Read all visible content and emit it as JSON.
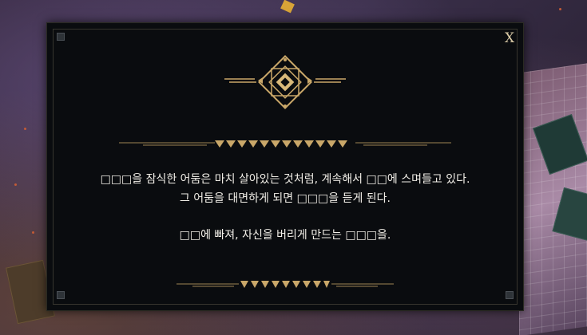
{
  "dialog": {
    "close_label": "X",
    "lines": [
      "□□□을 잠식한 어둠은 마치 살아있는 것처럼, 계속해서 □□에 스며들고 있다.",
      "그 어둠을 대면하게 되면 □□□을 듣게 된다.",
      "□□에 빠져, 자신을 버리게 만드는 □□□을."
    ]
  },
  "colors": {
    "gold": "#c9a769",
    "dialog_bg": "#0a0c0f",
    "text": "#f2efe8"
  },
  "icons": {
    "emblem": "diamond-crest-icon",
    "close": "close-icon"
  }
}
